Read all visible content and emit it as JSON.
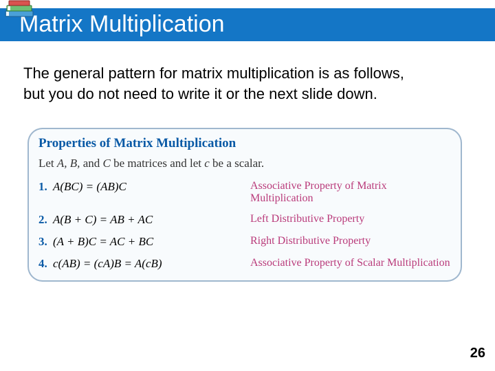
{
  "title": "Matrix Multiplication",
  "body_line1": "The general pattern for matrix multiplication is as follows,",
  "body_line2": "but you do not need to write it or the next slide down.",
  "box": {
    "heading": "Properties of Matrix Multiplication",
    "sub_pre": "Let ",
    "sub_vars": "A, B,",
    "sub_mid1": " and ",
    "sub_varC": "C",
    "sub_mid2": " be matrices and let ",
    "sub_varc": "c",
    "sub_post": " be a scalar.",
    "items": [
      {
        "num": "1.",
        "eq": "A(BC) = (AB)C",
        "desc": "Associative Property of Matrix Multiplication"
      },
      {
        "num": "2.",
        "eq": "A(B + C) = AB + AC",
        "desc": "Left Distributive Property"
      },
      {
        "num": "3.",
        "eq": "(A + B)C = AC + BC",
        "desc": "Right Distributive Property"
      },
      {
        "num": "4.",
        "eq": "c(AB) = (cA)B = A(cB)",
        "desc": "Associative Property of Scalar Multiplication"
      }
    ]
  },
  "page_number": "26",
  "icons": {
    "books": "books-icon"
  }
}
